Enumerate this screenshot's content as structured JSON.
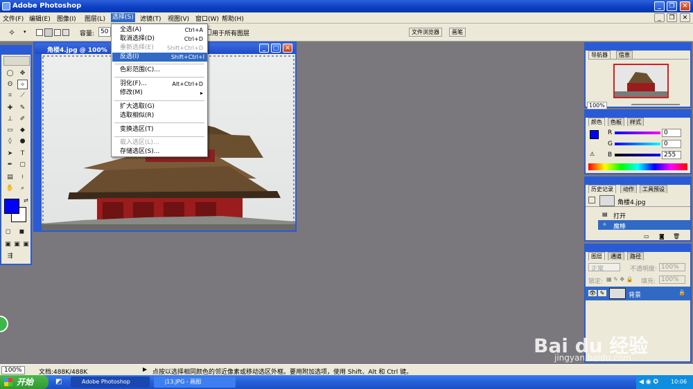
{
  "app": {
    "title": "Adobe Photoshop"
  },
  "menu": [
    "文件(F)",
    "编辑(E)",
    "图像(I)",
    "图层(L)",
    "选择(S)",
    "滤镜(T)",
    "视图(V)",
    "窗口(W)",
    "帮助(H)"
  ],
  "options": {
    "tolerance_label": "容量:",
    "tolerance_value": "50",
    "all_layers": "用于所有图层",
    "well_tabs": [
      "文件浏览器",
      "画笔"
    ]
  },
  "dropdown": [
    {
      "label": "全选(A)",
      "shortcut": "Ctrl+A",
      "state": "normal"
    },
    {
      "label": "取消选择(D)",
      "shortcut": "Ctrl+D",
      "state": "normal"
    },
    {
      "label": "重新选择(E)",
      "shortcut": "Shift+Ctrl+D",
      "state": "disabled"
    },
    {
      "label": "反选(I)",
      "shortcut": "Shift+Ctrl+I",
      "state": "selected"
    },
    {
      "label": "色彩范围(C)...",
      "shortcut": "",
      "state": "normal"
    },
    {
      "label": "羽化(F)...",
      "shortcut": "Alt+Ctrl+D",
      "state": "normal"
    },
    {
      "label": "修改(M)",
      "shortcut": "▸",
      "state": "normal"
    },
    {
      "label": "扩大选取(G)",
      "shortcut": "",
      "state": "normal"
    },
    {
      "label": "选取相似(R)",
      "shortcut": "",
      "state": "normal"
    },
    {
      "label": "变换选区(T)",
      "shortcut": "",
      "state": "normal"
    },
    {
      "label": "载入选区(L)...",
      "shortcut": "",
      "state": "disabled"
    },
    {
      "label": "存储选区(S)...",
      "shortcut": "",
      "state": "normal"
    }
  ],
  "document": {
    "title": "角楼4.jpg @ 100%"
  },
  "navigator": {
    "tabs": [
      "导航器",
      "信息"
    ],
    "zoom": "100%"
  },
  "color": {
    "tabs": [
      "颜色",
      "色板",
      "样式"
    ],
    "r": "0",
    "g": "0",
    "b": "255",
    "fg": "#0000ff"
  },
  "history": {
    "tabs": [
      "历史记录",
      "动作",
      "工具预设"
    ],
    "snapshot": "角楼4.jpg",
    "items": [
      "打开",
      "魔棒"
    ]
  },
  "layers": {
    "tabs": [
      "图层",
      "通道",
      "路径"
    ],
    "mode": "正常",
    "opacity_label": "不透明度:",
    "opacity": "100%",
    "lock_label": "锁定:",
    "fill_label": "填充:",
    "fill": "100%",
    "layer": "背景"
  },
  "status": {
    "zoom": "100%",
    "doc": "文档:488K/488K",
    "hint": "点按以选择相同颜色的邻近像素或移动选区外框。要用附加选项，使用 Shift、Alt 和 Ctrl 键。"
  },
  "taskbar": {
    "start": "开始",
    "items": [
      "Adobe Photoshop",
      "j13.JPG - 画图"
    ],
    "time": "10:06"
  },
  "watermark": {
    "brand": "Bai du 经验",
    "url": "jingyan.baidu.com"
  }
}
